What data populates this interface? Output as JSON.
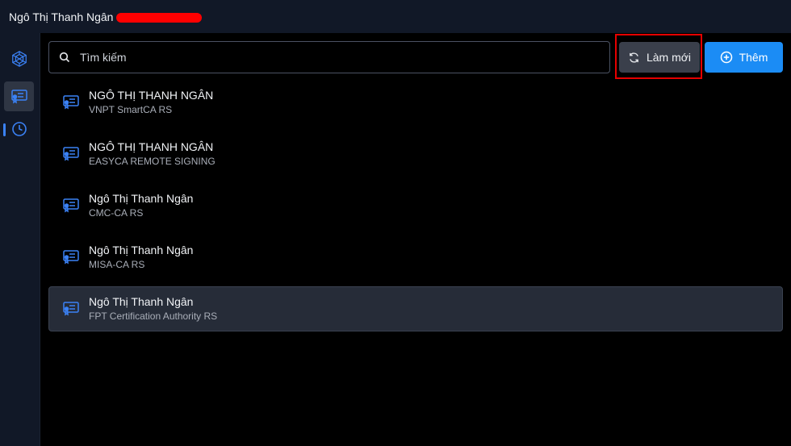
{
  "window": {
    "title": "Ngô Thị Thanh Ngân"
  },
  "sidebar": {
    "items": [
      {
        "icon": "network-logo-icon"
      },
      {
        "icon": "certificate-icon",
        "active": true
      },
      {
        "icon": "clock-icon"
      }
    ]
  },
  "search": {
    "placeholder": "Tìm kiếm",
    "value": ""
  },
  "toolbar": {
    "refresh_label": "Làm mới",
    "add_label": "Thêm"
  },
  "certificates": [
    {
      "name": "NGÔ THỊ THANH NGÂN",
      "provider": "VNPT SmartCA RS"
    },
    {
      "name": "NGÔ THỊ THANH NGÂN",
      "provider": "EASYCA REMOTE SIGNING"
    },
    {
      "name": "Ngô Thị Thanh Ngân",
      "provider": "CMC-CA RS"
    },
    {
      "name": "Ngô Thị Thanh Ngân",
      "provider": "MISA-CA RS"
    },
    {
      "name": "Ngô Thị Thanh Ngân",
      "provider": "FPT Certification Authority RS",
      "selected": true
    }
  ],
  "colors": {
    "accent": "#1b8cf5",
    "highlight": "#e60000",
    "panel": "#111827"
  }
}
